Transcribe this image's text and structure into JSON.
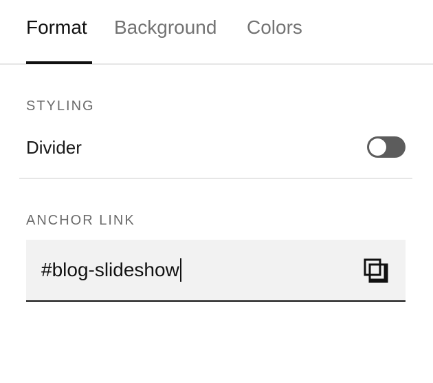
{
  "tabs": [
    {
      "label": "Format",
      "active": true
    },
    {
      "label": "Background",
      "active": false
    },
    {
      "label": "Colors",
      "active": false
    }
  ],
  "styling": {
    "heading": "STYLING",
    "divider_label": "Divider",
    "divider_enabled": false
  },
  "anchor": {
    "heading": "ANCHOR LINK",
    "value": "#blog-slideshow",
    "copy_icon": "copy-icon"
  },
  "colors": {
    "active_tab": "#111111",
    "inactive_tab": "#737373",
    "heading": "#6b6b6b",
    "toggle_off": "#5c5c5c",
    "field_background": "#f2f2f2"
  }
}
